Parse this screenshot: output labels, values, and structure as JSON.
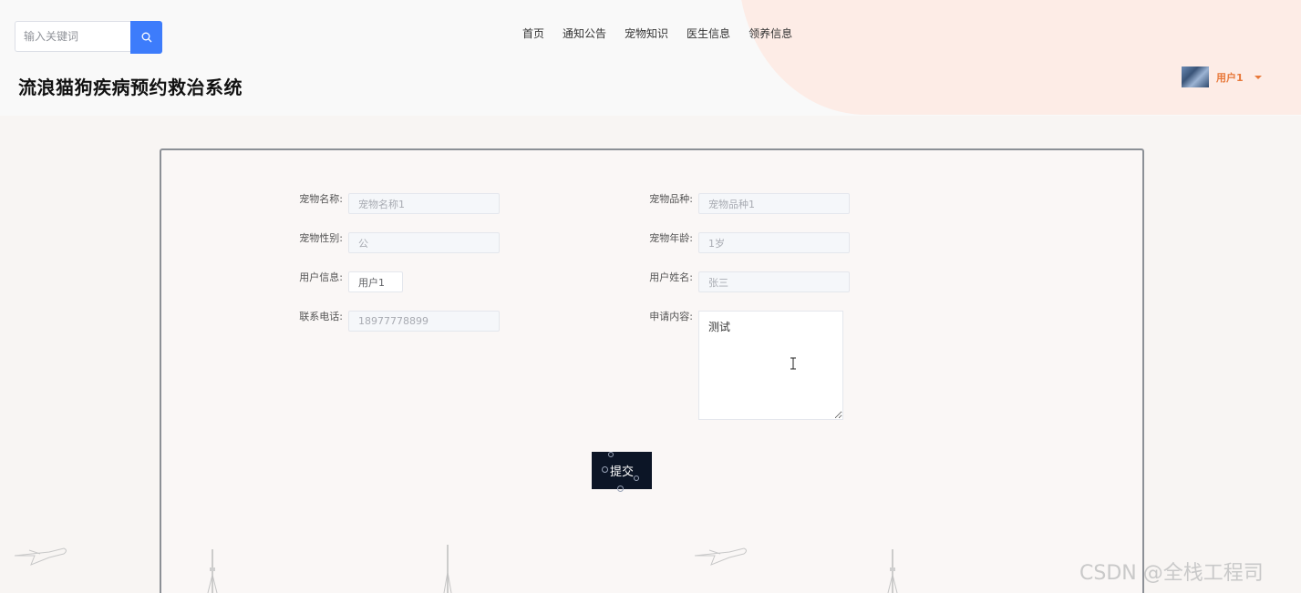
{
  "header": {
    "search": {
      "placeholder": "输入关键词"
    },
    "nav": [
      {
        "label": "首页"
      },
      {
        "label": "通知公告"
      },
      {
        "label": "宠物知识"
      },
      {
        "label": "医生信息"
      },
      {
        "label": "领养信息"
      }
    ],
    "site_title": "流浪猫狗疾病预约救治系统",
    "user": {
      "name": "用户1"
    }
  },
  "form": {
    "pet_name": {
      "label": "宠物名称:",
      "value": "宠物名称1"
    },
    "pet_breed": {
      "label": "宠物品种:",
      "value": "宠物品种1"
    },
    "pet_gender": {
      "label": "宠物性别:",
      "value": "公"
    },
    "pet_age": {
      "label": "宠物年龄:",
      "value": "1岁"
    },
    "user_info": {
      "label": "用户信息:",
      "value": "用户1"
    },
    "user_name": {
      "label": "用户姓名:",
      "value": "张三"
    },
    "phone": {
      "label": "联系电话:",
      "value": "18977778899"
    },
    "apply_content": {
      "label": "申请内容:",
      "value": "测试"
    },
    "submit_label": "提交"
  },
  "watermark": "CSDN @全栈工程司",
  "colors": {
    "accent_blue": "#3d7cfb",
    "user_orange": "#e8793b",
    "header_blob": "#fdece6",
    "submit_bg": "#0c1526"
  },
  "icons": {
    "search": "search-icon",
    "dropdown": "caret-down-icon",
    "cursor": "text-cursor-icon"
  }
}
